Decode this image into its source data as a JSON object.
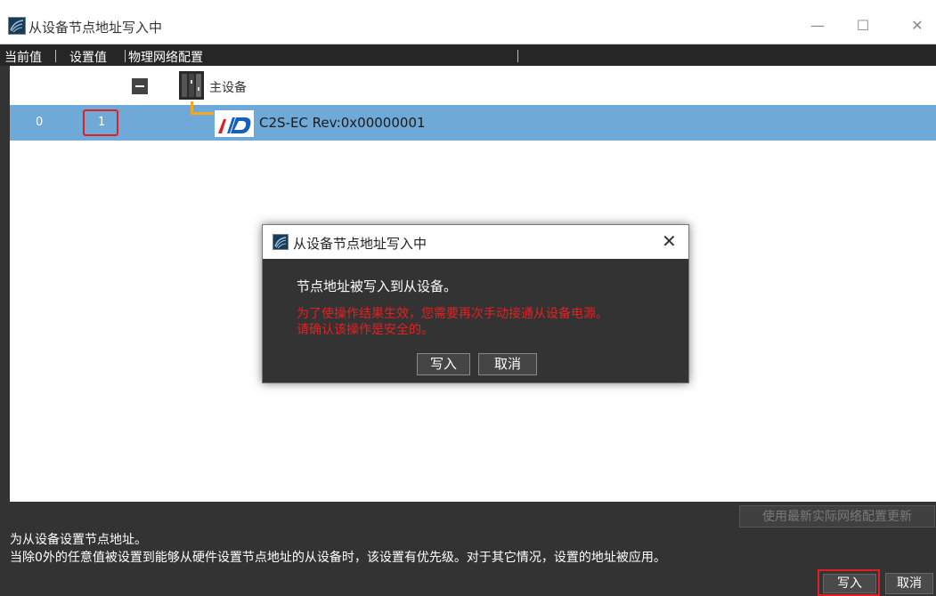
{
  "window": {
    "title": "从设备节点地址写入中",
    "min_glyph": "—",
    "max_glyph": "☐",
    "close_glyph": "✕",
    "icon": "network-app-icon"
  },
  "columns": {
    "current": "当前值",
    "set": "设置值",
    "config": "物理网络配置"
  },
  "tree": {
    "master": {
      "label": "主设备",
      "icon": "plc-master-icon"
    },
    "slave": {
      "current": "0",
      "set": "1",
      "label": "C2S-EC Rev:0x00000001",
      "icon": "servo-drive-logo-icon"
    }
  },
  "footer": {
    "update_button": "使用最新实际网络配置更新",
    "description_line1": "为从设备设置节点地址。",
    "description_line2": "当除0外的任意值被设置到能够从硬件设置节点地址的从设备时，该设置有优先级。对于其它情况，设置的地址被应用。",
    "write_button": "写入",
    "cancel_button": "取消"
  },
  "dialog": {
    "title": "从设备节点地址写入中",
    "close_glyph": "✕",
    "message": "节点地址被写入到从设备。",
    "warning_line1": "为了使操作结果生效，您需要再次手动接通从设备电源。",
    "warning_line2": "请确认该操作是安全的。",
    "write_button": "写入",
    "cancel_button": "取消"
  },
  "colors": {
    "selected_row": "#6ea9d8",
    "highlight_frame": "#e02020",
    "warning_text": "#e52020",
    "connector": "#f5a623"
  }
}
